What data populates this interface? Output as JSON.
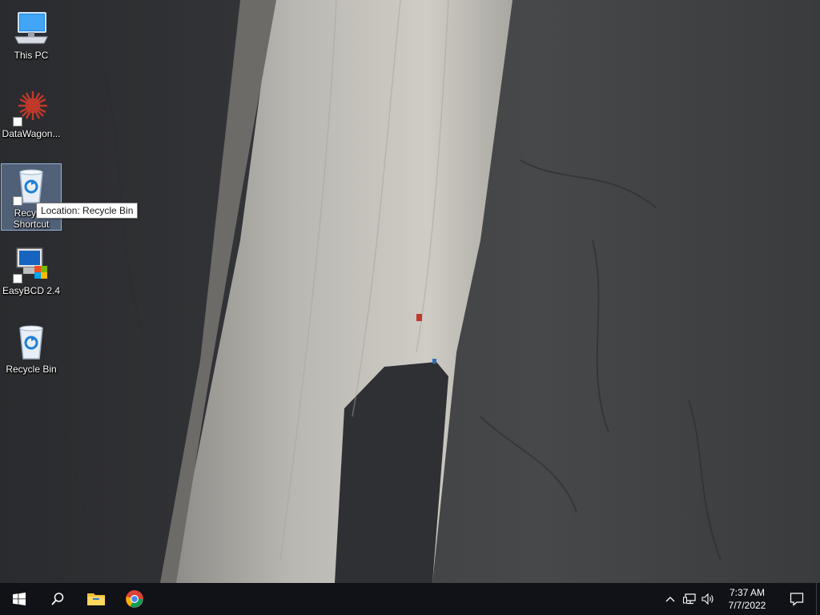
{
  "desktop": {
    "icons": [
      {
        "label": "This PC",
        "icon": "this-pc-icon",
        "shortcut": false
      },
      {
        "label": "DataWagon...",
        "icon": "datawagon-icon",
        "shortcut": true
      },
      {
        "label_line1": "Recycle",
        "label_line2": "Shortcut",
        "icon": "recycle-bin-icon",
        "shortcut": true,
        "selected": true
      },
      {
        "label": "EasyBCD 2.4",
        "icon": "easybcd-icon",
        "shortcut": true
      },
      {
        "label": "Recycle Bin",
        "icon": "recycle-bin-icon",
        "shortcut": false
      }
    ],
    "tooltip": "Location: Recycle Bin"
  },
  "taskbar": {
    "buttons": [
      {
        "name": "start",
        "icon": "windows-logo-icon"
      },
      {
        "name": "search",
        "icon": "search-icon"
      },
      {
        "name": "file-explorer",
        "icon": "folder-icon"
      },
      {
        "name": "chrome",
        "icon": "chrome-icon"
      }
    ],
    "tray": {
      "icons": [
        "chevron-up-icon",
        "network-icon",
        "volume-icon"
      ],
      "time": "7:37 AM",
      "date": "7/7/2022",
      "notification_icon": "action-center-icon"
    },
    "background": "#101217"
  }
}
